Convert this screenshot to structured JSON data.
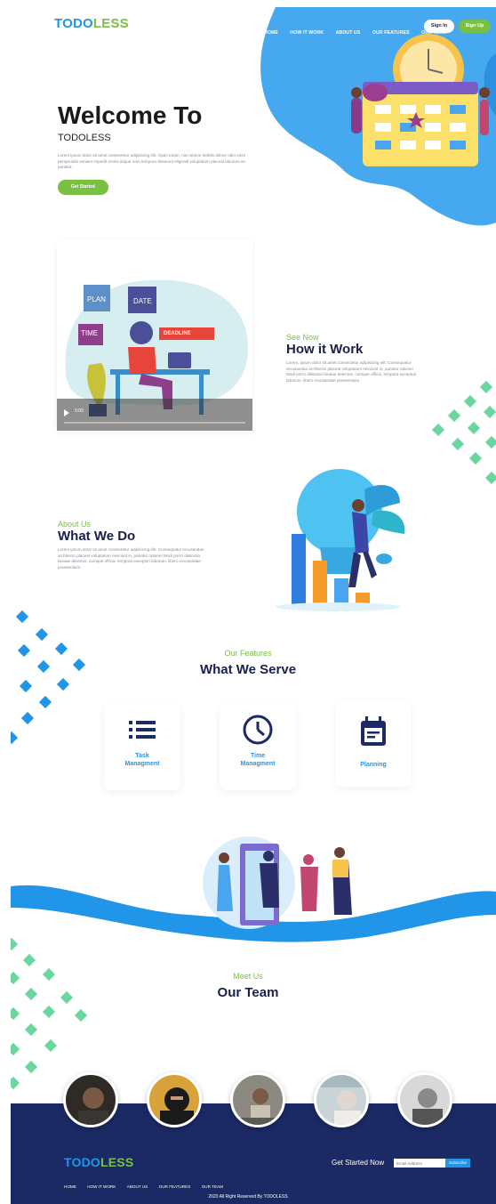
{
  "brand": {
    "part1": "TODO",
    "part2": "LESS"
  },
  "nav": {
    "items": [
      "HOME",
      "HOW IT WORK",
      "ABOUT US",
      "OUR FEATURES",
      "OUR TEAM"
    ],
    "signin": "Sign In",
    "signup": "Sign Up"
  },
  "hero": {
    "title": "Welcome To",
    "subtitle": "TODOLESS",
    "text": "Lorem ipsum dolor sit amet consectetur adipisicing elit. Optio totam, nisi ratione debitis dolore odio enim perspiciatis veniam impedit omnis itaque nam tempora deserunt eligendi voluptatum placeat laborum se pariatur.",
    "cta": "Get Started"
  },
  "how": {
    "eyebrow": "See Now",
    "title": "How it Work",
    "text": "Lorem, ipsum dolor sit amet consectetur adipisicing elit. Consequatur recusandae architecto placeat voluptatum nesciunt in, pariatur ratione! Modi porro distinctio beatae delectus, cumque officia, tempora excepturi laborum, libero recusandae praesentium.",
    "video_time": "0:00",
    "illus": {
      "plan": "PLAN",
      "date": "DATE",
      "time": "TIME",
      "deadline": "DEADLINE"
    }
  },
  "about": {
    "eyebrow": "About Us",
    "title": "What We Do",
    "text": "Lorem ipsum dolor sit amet consectetur adipisicing elit. Consequatur recusandae architecto placeat voluptatum nesciunt in, pariatur ratione! Modi porro distinctio beatae delectus, cumque officia, tempora excepturi laborum, libero recusandae praesentium."
  },
  "features": {
    "eyebrow": "Our Features",
    "title": "What We Serve",
    "cards": [
      {
        "label": "Task\nManagment",
        "icon": "list-icon"
      },
      {
        "label": "Time\nManagment",
        "icon": "clock-icon"
      },
      {
        "label": "Planning",
        "icon": "calendar-icon"
      }
    ]
  },
  "team": {
    "eyebrow": "Meet Us",
    "title": "Our Team"
  },
  "footer": {
    "nav": [
      "HOME",
      "HOW IT WORK",
      "ABOUT US",
      "OUR FEATURES",
      "OUR TEAM"
    ],
    "subscribe_title": "Get Started Now",
    "email_placeholder": "Email Address",
    "subscribe_button": "Subscribe",
    "copyright": "2020 All Right Reserved By TODOLESS"
  },
  "colors": {
    "blue": "#2196e8",
    "green": "#7ac043",
    "navy": "#1b2a64",
    "mint": "#6cd6a0"
  }
}
